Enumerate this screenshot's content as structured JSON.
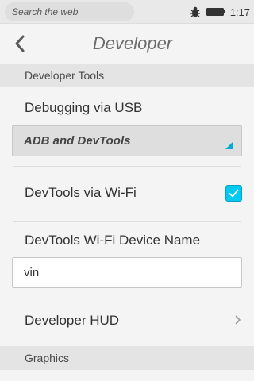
{
  "statusbar": {
    "search_placeholder": "Search the web",
    "time": "1:17",
    "icons": [
      "bug-icon",
      "battery-icon"
    ]
  },
  "header": {
    "title": "Developer",
    "back_icon": "chevron-left-icon"
  },
  "sections": [
    {
      "title": "Developer Tools"
    },
    {
      "title": "Graphics"
    }
  ],
  "items": {
    "debugging_usb": {
      "label": "Debugging via USB",
      "selected": "ADB and DevTools"
    },
    "devtools_wifi": {
      "label": "DevTools via Wi-Fi",
      "checked": true
    },
    "device_name": {
      "label": "DevTools Wi-Fi Device Name",
      "value": "vin"
    },
    "developer_hud": {
      "label": "Developer HUD"
    }
  },
  "colors": {
    "accent": "#00caf2",
    "section_bg": "#e4e4e4",
    "page_bg": "#f4f4f4"
  }
}
